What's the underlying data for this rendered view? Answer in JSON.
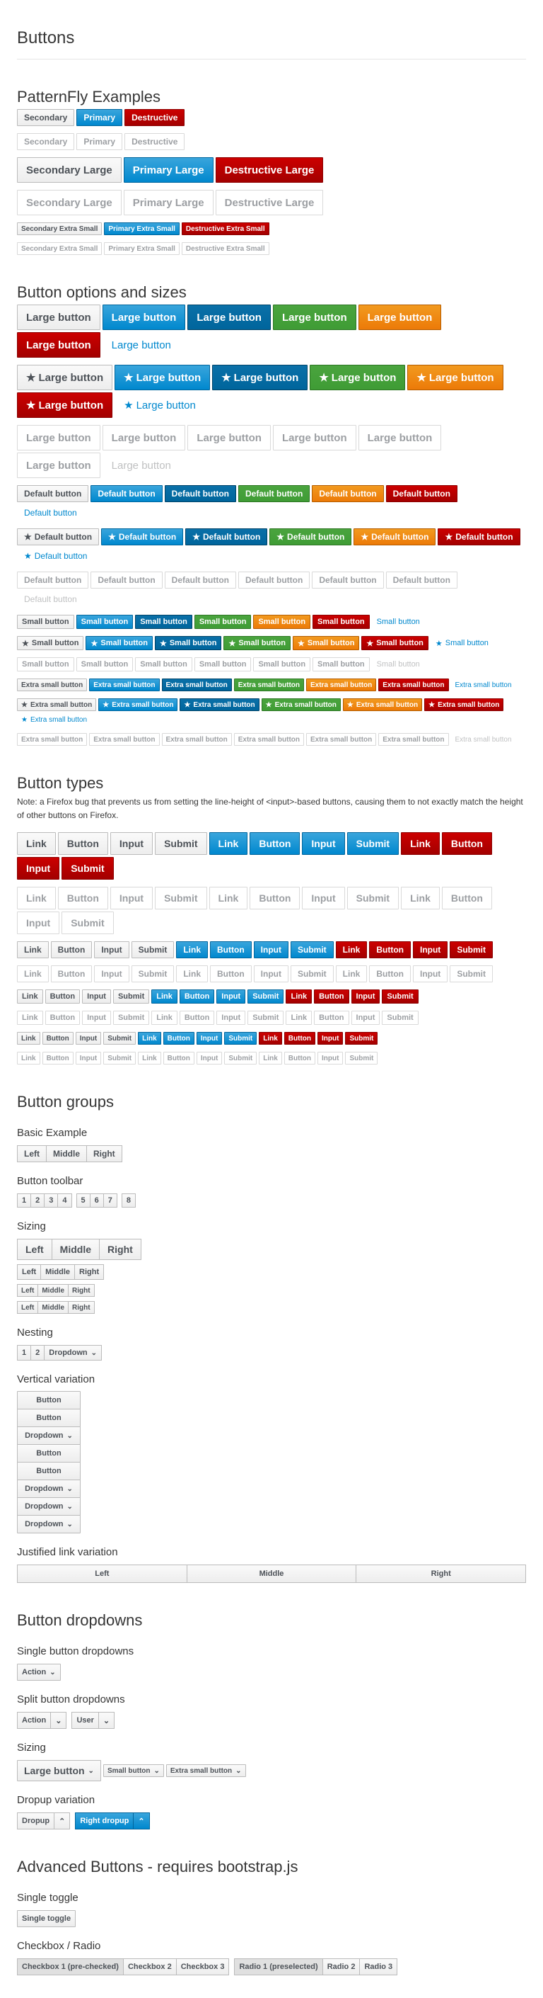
{
  "page_title": "Buttons",
  "sections": {
    "pf_examples": "PatternFly Examples",
    "options": "Button options and sizes",
    "types": "Button types",
    "groups": "Button groups",
    "dropdowns": "Button dropdowns",
    "advanced": "Advanced Buttons - requires bootstrap.js"
  },
  "pf": {
    "secondary": "Secondary",
    "primary": "Primary",
    "destructive": "Destructive",
    "secondary_lg": "Secondary Large",
    "primary_lg": "Primary Large",
    "destructive_lg": "Destructive Large",
    "secondary_xs": "Secondary Extra Small",
    "primary_xs": "Primary Extra Small",
    "destructive_xs": "Destructive Extra Small"
  },
  "opts": {
    "large": "Large button",
    "default": "Default button",
    "small": "Small button",
    "xsmall": "Extra small button"
  },
  "types": {
    "note": "Note: a Firefox bug that prevents us from setting the line-height of <input>-based buttons, causing them to not exactly match the height of other buttons on Firefox.",
    "link": "Link",
    "button": "Button",
    "input": "Input",
    "submit": "Submit"
  },
  "groups": {
    "basic": "Basic Example",
    "toolbar": "Button toolbar",
    "sizing": "Sizing",
    "nesting": "Nesting",
    "vertical": "Vertical variation",
    "justified": "Justified link variation",
    "left": "Left",
    "middle": "Middle",
    "right": "Right",
    "n1": "1",
    "n2": "2",
    "n3": "3",
    "n4": "4",
    "n5": "5",
    "n6": "6",
    "n7": "7",
    "n8": "8",
    "button": "Button",
    "dropdown": "Dropdown"
  },
  "dropdowns": {
    "single": "Single button dropdowns",
    "split": "Split button dropdowns",
    "sizing": "Sizing",
    "dropup": "Dropup variation",
    "action": "Action",
    "user": "User",
    "large": "Large button",
    "small": "Small button",
    "xsmall": "Extra small button",
    "dropup_btn": "Dropup",
    "right_dropup": "Right dropup"
  },
  "advanced": {
    "single_toggle_h": "Single toggle",
    "single_toggle": "Single toggle",
    "checkbox_h": "Checkbox / Radio",
    "cb1": "Checkbox 1 (pre-checked)",
    "cb2": "Checkbox 2",
    "cb3": "Checkbox 3",
    "r1": "Radio 1 (preselected)",
    "r2": "Radio 2",
    "r3": "Radio 3"
  },
  "icons": {
    "star": "star-icon",
    "caret_down": "chevron-down-icon",
    "caret_up": "chevron-up-icon"
  }
}
